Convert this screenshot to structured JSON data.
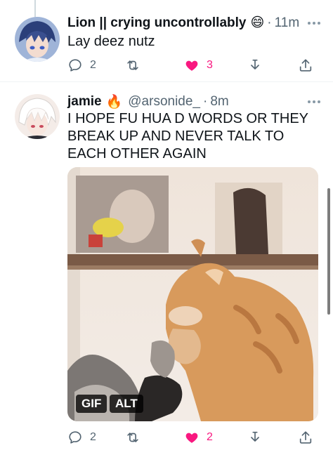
{
  "tweets": [
    {
      "author_name": "Lion || crying uncontrollably",
      "author_emoji": "😄",
      "separator": "·",
      "time": "11m",
      "text": "Lay deez nutz",
      "replies": "2",
      "retweets": "",
      "likes": "3"
    },
    {
      "author_name": "jamie",
      "author_emoji": "🔥",
      "handle": "@arsonide_",
      "separator": "·",
      "time": "8m",
      "text": "I HOPE FU HUA D WORDS OR THEY BREAK UP AND NEVER TALK TO EACH OTHER AGAIN",
      "media_badges": {
        "gif": "GIF",
        "alt": "ALT"
      },
      "replies": "2",
      "retweets": "",
      "likes": "2"
    }
  ],
  "icons": {
    "reply": "reply-icon",
    "retweet": "retweet-icon",
    "like": "heart-filled-icon",
    "share": "share-arrow-icon",
    "upload": "upload-icon",
    "more": "more-dots-icon"
  },
  "colors": {
    "like_active": "#f91880",
    "muted_text": "#536471",
    "primary_text": "#0f1419",
    "thread_line": "#cfd9de"
  }
}
